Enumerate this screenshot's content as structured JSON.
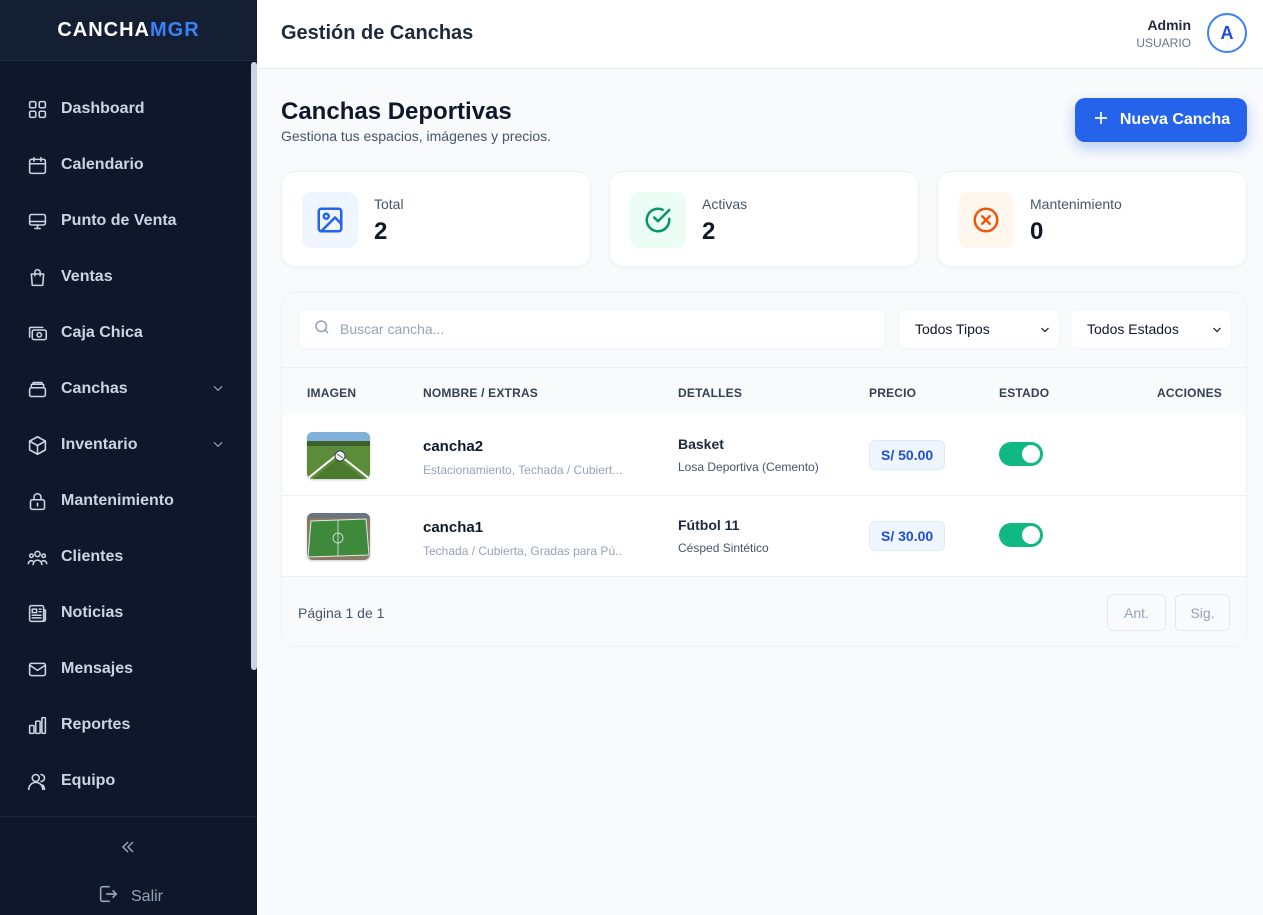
{
  "brand": {
    "part1": "CANCHA",
    "part2": "MGR"
  },
  "sidebar": {
    "items": [
      {
        "label": "Dashboard",
        "icon": "grid-icon"
      },
      {
        "label": "Calendario",
        "icon": "calendar-icon"
      },
      {
        "label": "Punto de Venta",
        "icon": "monitor-icon"
      },
      {
        "label": "Ventas",
        "icon": "shopping-bag-icon"
      },
      {
        "label": "Caja Chica",
        "icon": "cash-icon"
      },
      {
        "label": "Canchas",
        "icon": "stack-icon",
        "expandable": true
      },
      {
        "label": "Inventario",
        "icon": "cube-icon",
        "expandable": true
      },
      {
        "label": "Mantenimiento",
        "icon": "lock-icon"
      },
      {
        "label": "Clientes",
        "icon": "users-icon"
      },
      {
        "label": "Noticias",
        "icon": "newspaper-icon"
      },
      {
        "label": "Mensajes",
        "icon": "mail-icon"
      },
      {
        "label": "Reportes",
        "icon": "bar-chart-icon"
      },
      {
        "label": "Equipo",
        "icon": "team-icon"
      }
    ],
    "logout_label": "Salir"
  },
  "header": {
    "title": "Gestión de Canchas",
    "user_name": "Admin",
    "user_role": "USUARIO",
    "avatar_letter": "A"
  },
  "main": {
    "title": "Canchas Deportivas",
    "subtitle": "Gestiona tus espacios, imágenes y precios.",
    "new_button_label": "Nueva Cancha",
    "stats": [
      {
        "label": "Total",
        "value": "2",
        "icon": "image-icon"
      },
      {
        "label": "Activas",
        "value": "2",
        "icon": "check-circle-icon"
      },
      {
        "label": "Mantenimiento",
        "value": "0",
        "icon": "x-circle-icon"
      }
    ],
    "filters": {
      "search_placeholder": "Buscar cancha...",
      "type_select": "Todos Tipos",
      "status_select": "Todos Estados"
    },
    "table": {
      "columns": [
        "IMAGEN",
        "NOMBRE / EXTRAS",
        "DETALLES",
        "PRECIO",
        "ESTADO",
        "ACCIONES"
      ],
      "rows": [
        {
          "name": "cancha2",
          "extras": "Estacionamiento, Techada / Cubiert...",
          "type": "Basket",
          "surface": "Losa Deportiva (Cemento)",
          "price": "S/ 50.00",
          "active": true
        },
        {
          "name": "cancha1",
          "extras": "Techada / Cubierta, Gradas para Pú...",
          "type": "Fútbol 11",
          "surface": "Césped Sintético",
          "price": "S/ 30.00",
          "active": true
        }
      ]
    },
    "pagination": {
      "text": "Página 1 de 1",
      "prev_label": "Ant.",
      "next_label": "Sig."
    }
  },
  "colors": {
    "accent": "#2563eb",
    "sidebar_bg": "#0f172a",
    "success": "#10b981",
    "warning": "#ea580c"
  }
}
